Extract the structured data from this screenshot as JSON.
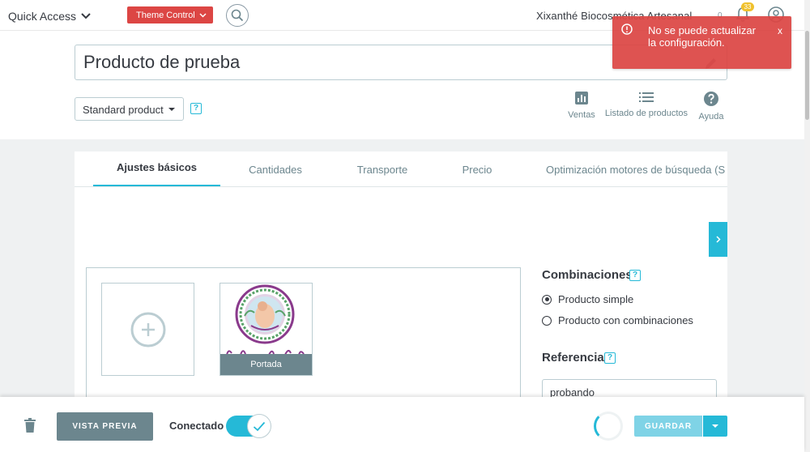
{
  "topbar": {
    "quick_access": "Quick Access",
    "theme_control": "Theme Control",
    "shop_name": "Xixanthé Biocosmética Artesanal",
    "counter": "0",
    "notifications_badge": "33"
  },
  "header": {
    "product_name": "Producto de prueba",
    "product_type": "Standard product",
    "help_glyph": "?",
    "toolbar": [
      {
        "label": "Ventas",
        "icon": "bar-chart-icon"
      },
      {
        "label": "Listado de productos",
        "icon": "list-icon"
      },
      {
        "label": "Ayuda",
        "icon": "help-circle-icon"
      }
    ]
  },
  "tabs": [
    {
      "label": "Ajustes básicos",
      "active": true
    },
    {
      "label": "Cantidades",
      "active": false
    },
    {
      "label": "Transporte",
      "active": false
    },
    {
      "label": "Precio",
      "active": false
    },
    {
      "label": "Optimización motores de búsqueda (S",
      "active": false
    }
  ],
  "images": {
    "cover_label": "Portada"
  },
  "combinations": {
    "title": "Combinaciones",
    "help_glyph": "?",
    "options": [
      {
        "label": "Producto simple",
        "checked": true
      },
      {
        "label": "Producto con combinaciones",
        "checked": false
      }
    ]
  },
  "reference": {
    "title": "Referencia",
    "help_glyph": "?",
    "value": "probando"
  },
  "footer": {
    "preview_label": "VISTA PREVIA",
    "connected_label": "Conectado",
    "connected_on": true,
    "save_label": "GUARDAR"
  },
  "toast": {
    "message": "No se puede actualizar la configuración.",
    "close_label": "x"
  },
  "colors": {
    "accent": "#25b9d7",
    "danger": "#dc4644",
    "muted": "#6c868e",
    "badge": "#f0c12d"
  }
}
